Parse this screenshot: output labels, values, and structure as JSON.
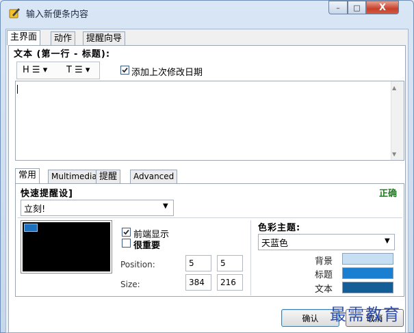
{
  "window": {
    "title": "输入新便条内容",
    "controls": {
      "minimize": "–",
      "maximize": "□",
      "close": "X"
    }
  },
  "main_tabs": [
    {
      "label": "主界面"
    },
    {
      "label": "动作"
    },
    {
      "label": "提醒向导"
    }
  ],
  "text_section": {
    "label": "文本 (第一行 - 标题):",
    "format_h": "H ☰ ▾",
    "format_t": "T ☰ ▾",
    "add_date_label": "添加上次修改日期",
    "add_date_checked": true,
    "content": ""
  },
  "sub_tabs": [
    {
      "label": "常用"
    },
    {
      "label": "Multimedia"
    },
    {
      "label": "提醒"
    },
    {
      "label": "Advanced"
    }
  ],
  "quick_reminder": {
    "label": "快速提醒设]",
    "status": "正确",
    "value": "立刻!"
  },
  "options": {
    "front_label": "前端显示",
    "front_checked": true,
    "important_label": "很重要",
    "important_checked": false
  },
  "geometry_fields": {
    "position_label": "Position:",
    "size_label": "Size:",
    "pos_x": "5",
    "pos_y": "5",
    "width": "384",
    "height": "216"
  },
  "theme": {
    "label": "色彩主题:",
    "value": "天蓝色",
    "background_label": "背景",
    "title_label": "标题",
    "text_label": "文本",
    "colors": {
      "background": "#c6dff2",
      "title": "#1b7fd1",
      "text": "#135e96"
    }
  },
  "buttons": {
    "ok": "确认",
    "cancel": "取消"
  },
  "watermark": "最需教育",
  "icons": [
    "app-note-icon",
    "checkbox-icon",
    "dropdown-arrow-icon",
    "scroll-up-icon",
    "scroll-down-icon"
  ]
}
